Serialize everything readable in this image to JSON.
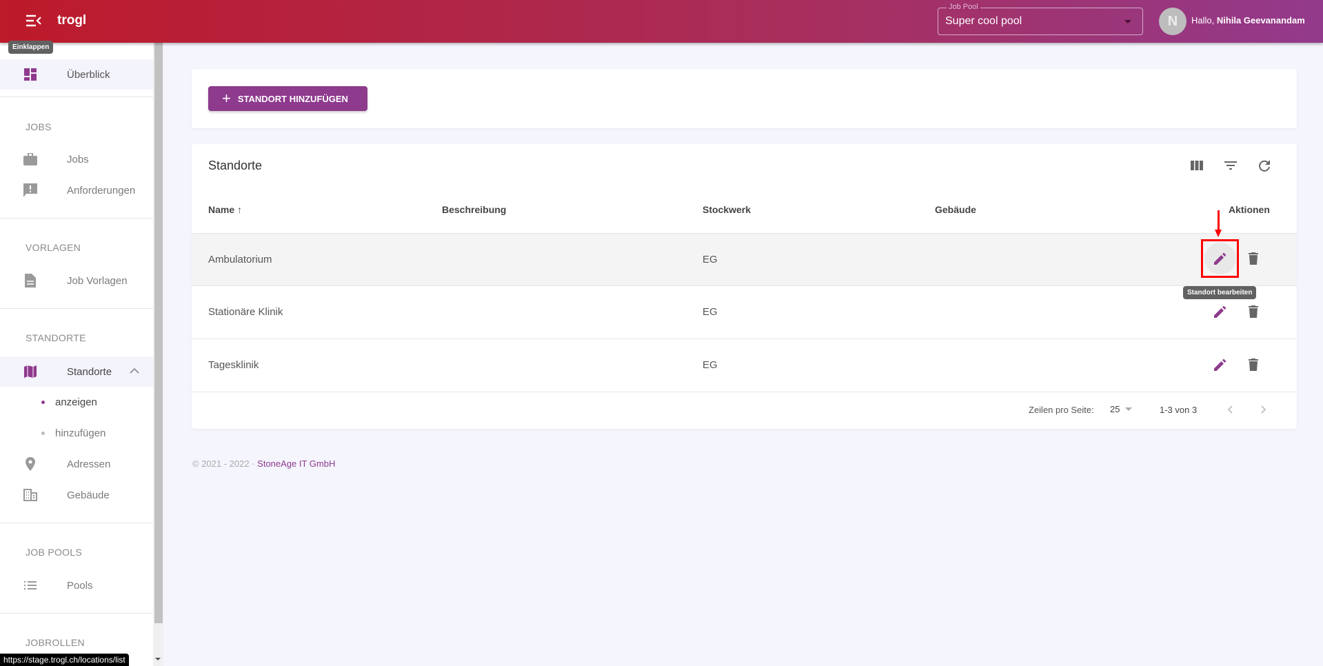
{
  "header": {
    "app_name": "trogl",
    "job_pool_label": "Job Pool",
    "job_pool_value": "Super cool pool",
    "avatar_initial": "N",
    "greeting": "Hallo,",
    "user_name": "Nihila Geevanandam",
    "collapse_tooltip": "Einklappen",
    "colors": {
      "gradient_start": "#bd1a2a",
      "gradient_end": "#933a8c",
      "accent": "#8e3a8d"
    }
  },
  "sidebar": {
    "overview": "Überblick",
    "sections": [
      {
        "title": "JOBS",
        "items": [
          "Jobs",
          "Anforderungen"
        ]
      },
      {
        "title": "VORLAGEN",
        "items": [
          "Job Vorlagen"
        ]
      },
      {
        "title": "STANDORTE",
        "items": [
          "Standorte"
        ],
        "subitems": [
          "anzeigen",
          "hinzufügen"
        ],
        "more": [
          "Adressen",
          "Gebäude"
        ]
      },
      {
        "title": "JOB POOLS",
        "items": [
          "Pools"
        ]
      },
      {
        "title": "JOBROLLEN",
        "items": []
      }
    ]
  },
  "toolbar": {
    "add_label": "STANDORT HINZUFÜGEN"
  },
  "table": {
    "title": "Standorte",
    "columns": [
      "Name",
      "Beschreibung",
      "Stockwerk",
      "Gebäude",
      "Aktionen"
    ],
    "sort": "Name ascending",
    "rows": [
      {
        "name": "Ambulatorium",
        "beschreibung": "",
        "stockwerk": "EG",
        "gebaeude": ""
      },
      {
        "name": "Stationäre Klinik",
        "beschreibung": "",
        "stockwerk": "EG",
        "gebaeude": ""
      },
      {
        "name": "Tagesklinik",
        "beschreibung": "",
        "stockwerk": "EG",
        "gebaeude": ""
      }
    ],
    "edit_tooltip": "Standort bearbeiten",
    "pagination": {
      "rows_per_page_label": "Zeilen pro Seite:",
      "rows_per_page": "25",
      "range": "1-3 von 3"
    }
  },
  "footer": {
    "copyright": "© 2021 - 2022 ·",
    "company": "StoneAge IT GmbH"
  },
  "status_url": "https://stage.trogl.ch/locations/list"
}
